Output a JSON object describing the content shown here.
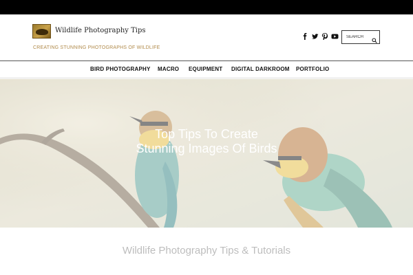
{
  "site": {
    "title": "Wildlife Photography Tips",
    "tagline": "CREATING STUNNING PHOTOGRAPHS OF WILDLIFE",
    "logo_icon": "bird-logo-icon"
  },
  "social": {
    "items": [
      {
        "name": "facebook-icon",
        "glyph": "f"
      },
      {
        "name": "twitter-icon",
        "glyph": "t"
      },
      {
        "name": "pinterest-icon",
        "glyph": "p"
      },
      {
        "name": "youtube-icon",
        "glyph": "youtube"
      }
    ]
  },
  "search": {
    "placeholder": "SEARCH",
    "icon": "search-icon"
  },
  "nav": {
    "items": [
      {
        "label": "BIRD PHOTOGRAPHY"
      },
      {
        "label": "MACRO"
      },
      {
        "label": "EQUIPMENT"
      },
      {
        "label": "DIGITAL DARKROOM"
      },
      {
        "label": "PORTFOLIO"
      }
    ]
  },
  "hero": {
    "title": "Top Tips To Create Stunning Images Of Birds"
  },
  "section": {
    "title": "Wildlife Photography Tips & Tutorials"
  },
  "colors": {
    "topbar": "#000000",
    "tagline": "#b08a4a",
    "section_title": "#bdbdbd"
  }
}
